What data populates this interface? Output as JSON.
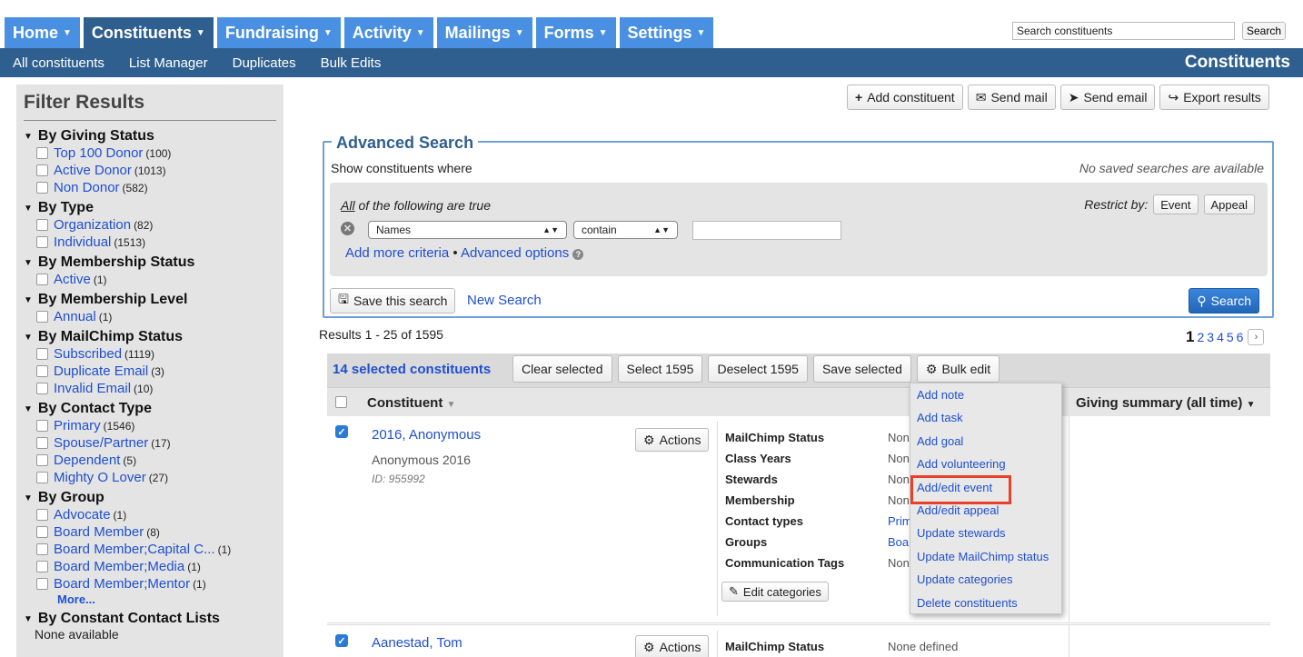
{
  "topnav": {
    "tabs": [
      {
        "label": "Home"
      },
      {
        "label": "Constituents"
      },
      {
        "label": "Fundraising"
      },
      {
        "label": "Activity"
      },
      {
        "label": "Mailings"
      },
      {
        "label": "Forms"
      },
      {
        "label": "Settings"
      }
    ],
    "search_value": "Search constituents",
    "search_button": "Search"
  },
  "subnav": {
    "items": [
      "All constituents",
      "List Manager",
      "Duplicates",
      "Bulk Edits"
    ],
    "section_title": "Constituents"
  },
  "sidebar": {
    "title": "Filter Results",
    "groups": [
      {
        "title": "By Giving Status",
        "items": [
          {
            "label": "Top 100 Donor",
            "count": "(100)"
          },
          {
            "label": "Active Donor",
            "count": "(1013)"
          },
          {
            "label": "Non Donor",
            "count": "(582)"
          }
        ]
      },
      {
        "title": "By Type",
        "items": [
          {
            "label": "Organization",
            "count": "(82)"
          },
          {
            "label": "Individual",
            "count": "(1513)"
          }
        ]
      },
      {
        "title": "By Membership Status",
        "items": [
          {
            "label": "Active",
            "count": "(1)"
          }
        ]
      },
      {
        "title": "By Membership Level",
        "items": [
          {
            "label": "Annual",
            "count": "(1)"
          }
        ]
      },
      {
        "title": "By MailChimp Status",
        "items": [
          {
            "label": "Subscribed",
            "count": "(1119)"
          },
          {
            "label": "Duplicate Email",
            "count": "(3)"
          },
          {
            "label": "Invalid Email",
            "count": "(10)"
          }
        ]
      },
      {
        "title": "By Contact Type",
        "items": [
          {
            "label": "Primary",
            "count": "(1546)"
          },
          {
            "label": "Spouse/Partner",
            "count": "(17)"
          },
          {
            "label": "Dependent",
            "count": "(5)"
          },
          {
            "label": "Mighty O Lover",
            "count": "(27)"
          }
        ]
      },
      {
        "title": "By Group",
        "items": [
          {
            "label": "Advocate",
            "count": "(1)"
          },
          {
            "label": "Board Member",
            "count": "(8)"
          },
          {
            "label": "Board Member;Capital C...",
            "count": "(1)"
          },
          {
            "label": "Board Member;Media",
            "count": "(1)"
          },
          {
            "label": "Board Member;Mentor",
            "count": "(1)"
          }
        ],
        "more": "More..."
      },
      {
        "title": "By Constant Contact Lists",
        "none": "None available"
      }
    ]
  },
  "toolbar": {
    "add_constituent": "Add constituent",
    "send_mail": "Send mail",
    "send_email": "Send email",
    "export_results": "Export results"
  },
  "advanced_search": {
    "legend": "Advanced Search",
    "show_where": "Show constituents where",
    "no_saved": "No saved searches are available",
    "all_word": "All",
    "all_rest": " of the following are true",
    "restrict_label": "Restrict by:",
    "restrict_event": "Event",
    "restrict_appeal": "Appeal",
    "field_select": "Names",
    "operator_select": "contain",
    "value": "",
    "add_more": "Add more criteria",
    "separator": " • ",
    "advanced_options": "Advanced options",
    "save_search": "Save this search",
    "new_search": "New Search",
    "search_button": "Search"
  },
  "results": {
    "count_text": "Results 1 - 25 of 1595",
    "pages": [
      "1",
      "2",
      "3",
      "4",
      "5",
      "6"
    ],
    "selected_text": "14 selected constituents",
    "clear_selected": "Clear selected",
    "select_all": "Select 1595",
    "deselect_all": "Deselect 1595",
    "save_selected": "Save selected",
    "bulk_edit": "Bulk edit",
    "col_constituent": "Constituent",
    "col_giving": "Giving summary (all time)"
  },
  "rows": [
    {
      "name": "2016, Anonymous",
      "sub": "Anonymous 2016",
      "id": "ID: 955992",
      "actions": "Actions",
      "categories": [
        {
          "k": "MailChimp Status",
          "v": "None"
        },
        {
          "k": "Class Years",
          "v": "None"
        },
        {
          "k": "Stewards",
          "v": "None"
        },
        {
          "k": "Membership",
          "v": "None"
        },
        {
          "k": "Contact types",
          "v": "Prim"
        },
        {
          "k": "Groups",
          "v": "Boa"
        },
        {
          "k": "Communication Tags",
          "v": "None"
        }
      ],
      "edit_categories": "Edit categories"
    },
    {
      "name": "Aanestad, Tom",
      "actions": "Actions",
      "categories": [
        {
          "k": "MailChimp Status",
          "v": "None defined"
        }
      ]
    }
  ],
  "bulk_menu": {
    "items": [
      "Add note",
      "Add task",
      "Add goal",
      "Add volunteering",
      "Add/edit event",
      "Add/edit appeal",
      "Update stewards",
      "Update MailChimp status",
      "Update categories",
      "Delete constituents"
    ],
    "highlighted_index": 4,
    "highlight_color": "#e8412a"
  }
}
